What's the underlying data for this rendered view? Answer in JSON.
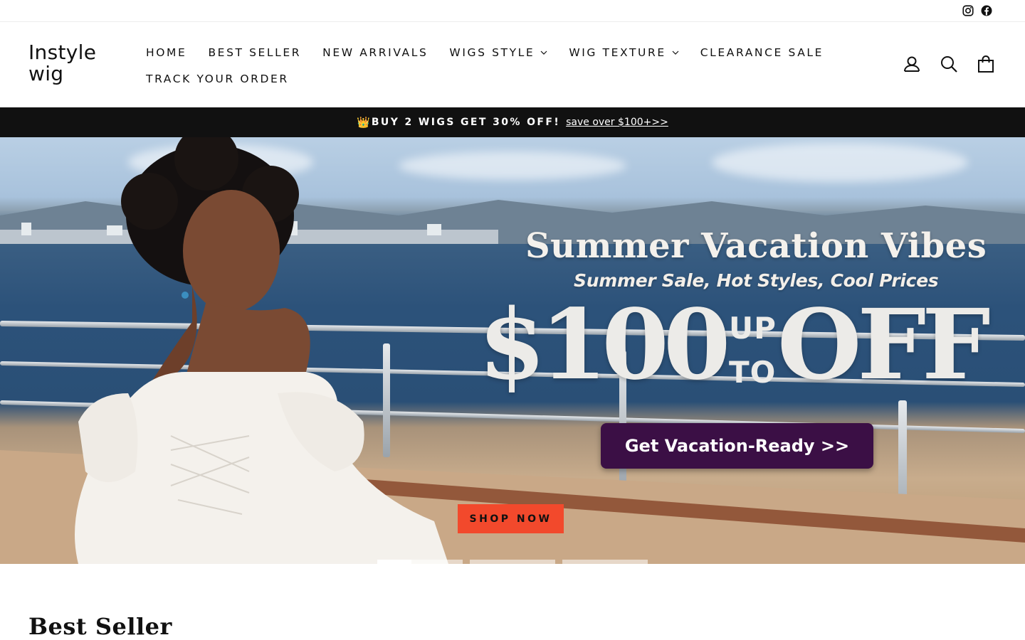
{
  "social": {
    "instagram_icon": "instagram-icon",
    "facebook_icon": "facebook-icon"
  },
  "header": {
    "logo_line1": "Instyle",
    "logo_line2": "wig",
    "nav": [
      {
        "label": "HOME"
      },
      {
        "label": "BEST SELLER"
      },
      {
        "label": "NEW ARRIVALS"
      },
      {
        "label": "WIGS STYLE",
        "has_dropdown": true
      },
      {
        "label": "WIG TEXTURE",
        "has_dropdown": true
      },
      {
        "label": "CLEARANCE SALE"
      },
      {
        "label": "TRACK YOUR ORDER"
      }
    ],
    "icons": [
      "user-icon",
      "search-icon",
      "bag-icon"
    ]
  },
  "announcement": {
    "crown": "👑",
    "promo": "BUY 2 WIGS GET 30% OFF!",
    "link": "save over $100+>>"
  },
  "hero": {
    "title": "Summer Vacation Vibes",
    "subtitle": "Summer Sale, Hot Styles, Cool Prices",
    "amount": "$100",
    "up": "UP",
    "to": "TO",
    "off": "OFF",
    "cta": "Get Vacation-Ready >>",
    "shop_now": "SHOP NOW",
    "slide_count": 4,
    "active_slide": 1,
    "colors": {
      "cta_bg": "#3b0f45",
      "shop_now_bg": "#f2492c",
      "announcement_bg": "#111111"
    }
  },
  "section": {
    "title": "Best Seller"
  }
}
